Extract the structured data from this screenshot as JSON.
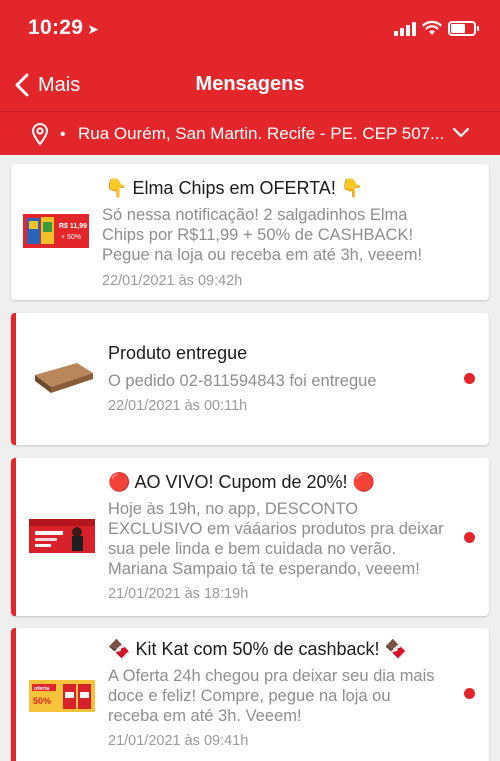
{
  "status_bar": {
    "time": "10:29",
    "location_arrow": "➤"
  },
  "nav": {
    "back_label": "Mais",
    "title": "Mensagens"
  },
  "address": {
    "bullet": "•",
    "text": "Rua Ourém, San Martin. Recife - PE. CEP 507..."
  },
  "messages": [
    {
      "emoji_left": "👇",
      "title": "Elma Chips em OFERTA!",
      "emoji_right": "👇",
      "body_lines": [
        "Só nessa notificação! 2 salgadinhos Elma",
        "Chips por R$11,99 + 50% de CASHBACK!",
        "Pegue na loja ou receba em até 3h, veeem!"
      ],
      "date": "22/01/2021 às 09:42h",
      "unread": false,
      "thumb": {
        "price": "R$ 11,99",
        "promo": "+ 50%"
      }
    },
    {
      "title": "Produto entregue",
      "body_lines": [
        "O pedido 02-811594843 foi entregue"
      ],
      "date": "22/01/2021 às 00:11h",
      "unread": true
    },
    {
      "emoji_left": "🔴",
      "title": "AO VIVO! Cupom de 20%!",
      "emoji_right": "🔴",
      "body_lines": [
        "Hoje às 19h, no app, DESCONTO",
        "EXCLUSIVO em vááarios produtos pra deixar",
        "sua pele linda e bem cuidada no verão.",
        "Mariana Sampaio tá te esperando, veeem!"
      ],
      "date": "21/01/2021 às 18:19h",
      "unread": true
    },
    {
      "emoji_left": "🍫",
      "title": "Kit Kat com 50% de cashback!",
      "emoji_right": "🍫",
      "body_lines": [
        "A Oferta 24h chegou pra deixar seu dia mais",
        "doce e feliz! Compre, pegue na loja ou",
        "receba em até 3h. Veeem!"
      ],
      "date": "21/01/2021 às 09:41h",
      "unread": true,
      "thumb": {
        "brand": "oferta",
        "promo": "50%"
      }
    }
  ],
  "colors": {
    "brand_red": "#e3262b",
    "background": "#efefef",
    "muted_text": "#8e8e8e"
  }
}
